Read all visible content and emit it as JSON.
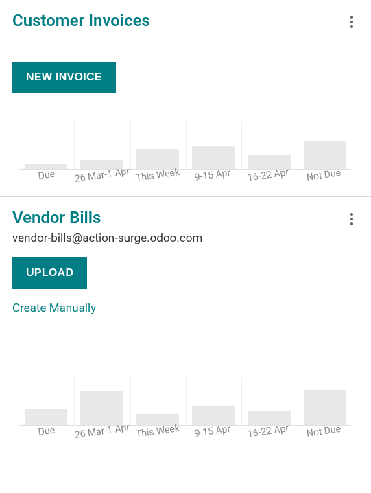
{
  "customer_invoices": {
    "title": "Customer Invoices",
    "new_button": "NEW INVOICE"
  },
  "vendor_bills": {
    "title": "Vendor Bills",
    "email": "vendor-bills@action-surge.odoo.com",
    "upload_button": "UPLOAD",
    "create_link": "Create Manually"
  },
  "chart_data": [
    {
      "type": "bar",
      "title": "Customer Invoices",
      "categories": [
        "Due",
        "26 Mar-1 Apr",
        "This Week",
        "9-15 Apr",
        "16-22 Apr",
        "Not Due"
      ],
      "values": [
        10,
        18,
        42,
        47,
        28,
        57
      ],
      "ylim": [
        0,
        100
      ]
    },
    {
      "type": "bar",
      "title": "Vendor Bills",
      "categories": [
        "Due",
        "26 Mar-1 Apr",
        "This Week",
        "9-15 Apr",
        "16-22 Apr",
        "Not Due"
      ],
      "values": [
        33,
        70,
        23,
        38,
        30,
        73
      ],
      "ylim": [
        0,
        100
      ]
    }
  ]
}
